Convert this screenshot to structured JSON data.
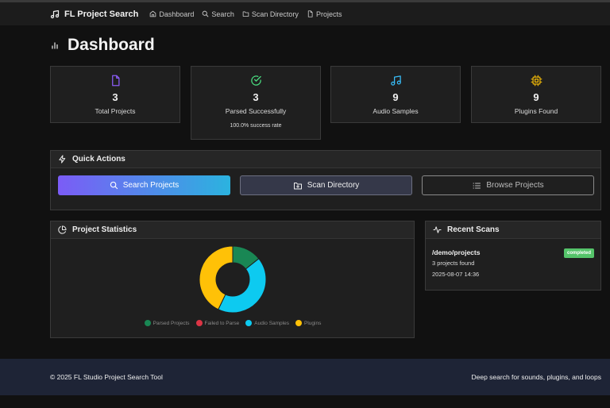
{
  "nav": {
    "brand": "FL Project Search",
    "links": [
      "Dashboard",
      "Search",
      "Scan Directory",
      "Projects"
    ]
  },
  "page": {
    "title": "Dashboard"
  },
  "stats": [
    {
      "icon": "file-icon",
      "value": "3",
      "label": "Total Projects",
      "color": "#8b5cf6"
    },
    {
      "icon": "check-circle-icon",
      "value": "3",
      "label": "Parsed Successfully",
      "sub": "100.0% success rate",
      "color": "#4ade80"
    },
    {
      "icon": "music-note-icon",
      "value": "9",
      "label": "Audio Samples",
      "color": "#38bdf8"
    },
    {
      "icon": "chip-icon",
      "value": "9",
      "label": "Plugins Found",
      "color": "#eab308"
    }
  ],
  "quick_actions": {
    "title": "Quick Actions",
    "buttons": [
      "Search Projects",
      "Scan Directory",
      "Browse Projects"
    ]
  },
  "project_statistics": {
    "title": "Project Statistics",
    "legend": [
      {
        "label": "Parsed Projects",
        "color": "#198754"
      },
      {
        "label": "Failed to Parse",
        "color": "#dc3545"
      },
      {
        "label": "Audio Samples",
        "color": "#0dcaf0"
      },
      {
        "label": "Plugins",
        "color": "#ffc107"
      }
    ]
  },
  "chart_data": {
    "type": "pie",
    "categories": [
      "Parsed Projects",
      "Failed to Parse",
      "Audio Samples",
      "Plugins"
    ],
    "values": [
      3,
      0,
      9,
      9
    ],
    "colors": [
      "#198754",
      "#dc3545",
      "#0dcaf0",
      "#ffc107"
    ],
    "donut": true,
    "legend": "bottom"
  },
  "recent_scans": {
    "title": "Recent Scans",
    "items": [
      {
        "path": "/demo/projects",
        "status": "completed",
        "count": "3 projects found",
        "date": "2025-08-07 14:36"
      }
    ]
  },
  "footer": {
    "left": "© 2025 FL Studio Project Search Tool",
    "right": "Deep search for sounds, plugins, and loops"
  }
}
